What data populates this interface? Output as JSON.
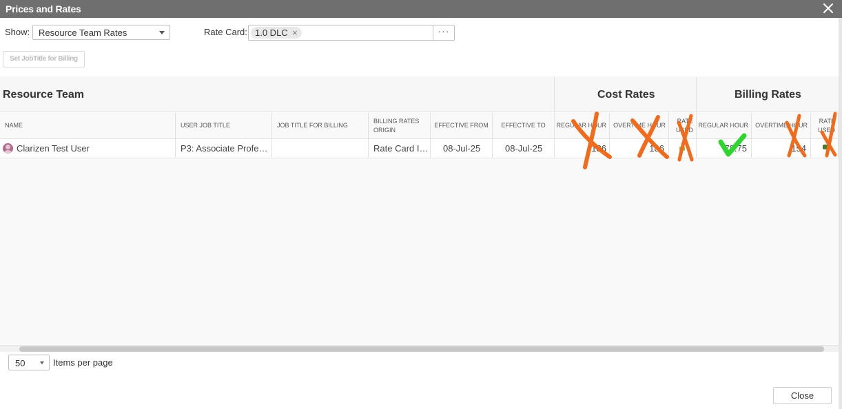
{
  "dialog": {
    "title": "Prices and Rates"
  },
  "filters": {
    "show_label": "Show:",
    "show_value": "Resource Team Rates",
    "rate_card_label": "Rate Card:",
    "rate_card_chip": "1.0 DLC",
    "chip_remove_glyph": "×",
    "more_glyph": "···"
  },
  "toolbar": {
    "set_job_title_label": "Set JobTitle for Billing"
  },
  "grid": {
    "group_headers": {
      "resource_team": "Resource Team",
      "cost_rates": "Cost Rates",
      "billing_rates": "Billing Rates"
    },
    "columns": {
      "name": "NAME",
      "user_job_title": "USER JOB TITLE",
      "job_title_for_billing": "JOB TITLE FOR BILLING",
      "billing_rates_origin": "BILLING RATES ORIGIN",
      "effective_from": "EFFECTIVE FROM",
      "effective_to": "EFFECTIVE TO",
      "cost_regular_hour": "REGULAR HOUR",
      "cost_overtime_hour": "OVERTIME HOUR",
      "cost_rate_used": "RATE USED",
      "billing_regular_hour": "REGULAR HOUR",
      "billing_overtime_hour": "OVERTIME HOUR",
      "billing_rate_used": "RATE USED"
    },
    "rows": [
      {
        "name": "Clarizen Test User",
        "user_job_title": "P3: Associate Profe…",
        "job_title_for_billing": "",
        "billing_rates_origin": "Rate Card I…",
        "effective_from": "08-Jul-25",
        "effective_to": "08-Jul-25",
        "cost_regular_hour": "186",
        "cost_overtime_hour": "186",
        "billing_regular_hour": "78.75",
        "billing_overtime_hour": "154"
      }
    ]
  },
  "pagination": {
    "page_size": "50",
    "items_per_page_label": "Items per page"
  },
  "footer": {
    "close_label": "Close"
  },
  "annotations": {
    "cross_color": "#f26a1b",
    "check_color": "#2fd62f",
    "cross_icon": "cross-mark-icon",
    "check_icon": "check-mark-icon"
  }
}
